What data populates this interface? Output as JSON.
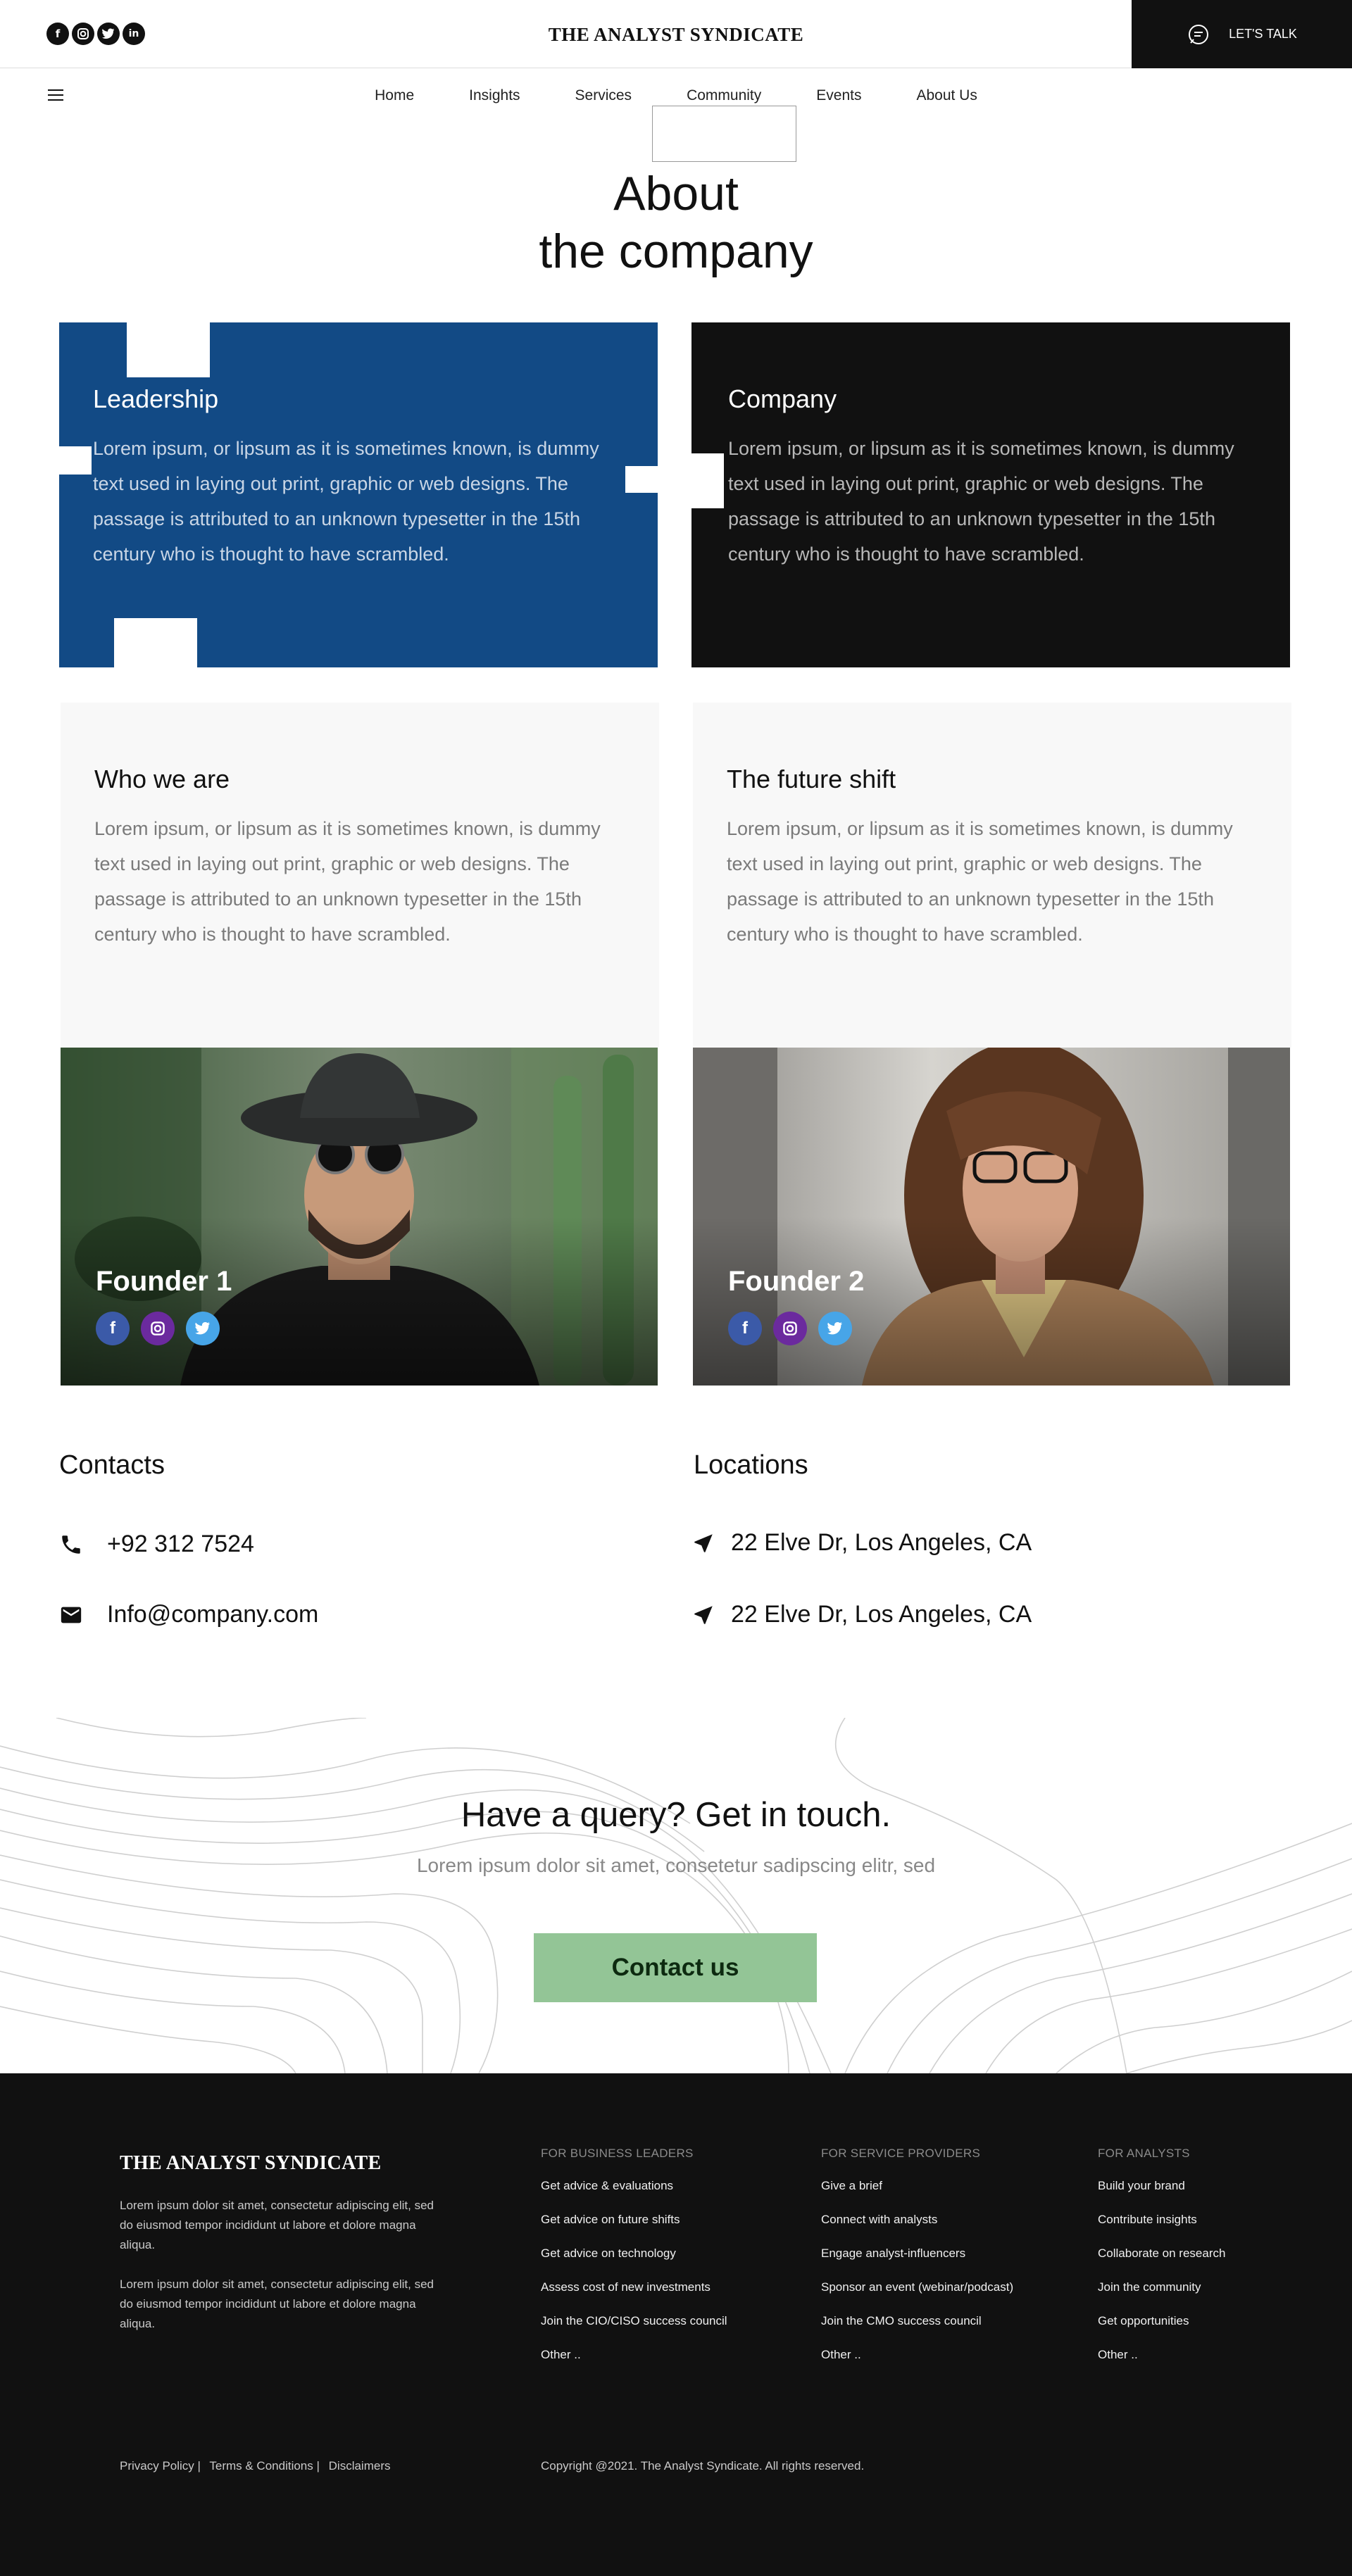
{
  "header": {
    "brand": "THE ANALYST SYNDICATE",
    "cta_label": "LET'S TALK",
    "social_icons": [
      "facebook-icon",
      "instagram-icon",
      "twitter-icon",
      "linkedin-icon"
    ]
  },
  "nav": {
    "items": [
      "Home",
      "Insights",
      "Services",
      "Community",
      "Events",
      "About Us"
    ]
  },
  "hero": {
    "line1": "About",
    "line2": "the company"
  },
  "cards": [
    {
      "title": "Leadership",
      "body": "Lorem ipsum, or lipsum as it is sometimes known, is dummy text used in laying out print, graphic or web designs. The passage is attributed to an unknown typesetter in the 15th century who is thought to have scrambled.",
      "color": "#124a85"
    },
    {
      "title": "Company",
      "body": "Lorem ipsum, or lipsum as it is sometimes known, is dummy text used in laying out print, graphic or web designs. The passage is attributed to an unknown typesetter in the 15th century who is thought to have scrambled.",
      "color": "#111111"
    },
    {
      "title": "Who we are",
      "body": "Lorem ipsum, or lipsum as it is sometimes known, is dummy text used in laying out print, graphic or web designs. The passage is attributed to an unknown typesetter in the 15th century who is thought to have scrambled.",
      "color": "#f8f8f8"
    },
    {
      "title": "The future shift",
      "body": "Lorem ipsum, or lipsum as it is sometimes known, is dummy text used in laying out print, graphic or web designs. The passage is attributed to an unknown typesetter in the 15th century who is thought to have scrambled.",
      "color": "#f8f8f8"
    }
  ],
  "founders": [
    {
      "name": "Founder 1",
      "icons": [
        "facebook-icon",
        "instagram-icon",
        "twitter-icon"
      ]
    },
    {
      "name": "Founder 2",
      "icons": [
        "facebook-icon",
        "instagram-icon",
        "twitter-icon"
      ]
    }
  ],
  "contacts": {
    "heading": "Contacts",
    "phone": "+92 312 7524",
    "email": "Info@company.com"
  },
  "locations": {
    "heading": "Locations",
    "items": [
      "22 Elve Dr, Los Angeles, CA",
      "22 Elve Dr, Los Angeles, CA"
    ]
  },
  "cta": {
    "title": "Have a query? Get in touch.",
    "subtitle": "Lorem ipsum dolor sit amet, consetetur sadipscing elitr, sed",
    "button": "Contact us",
    "button_color": "#93c596"
  },
  "footer": {
    "brand": "THE ANALYST SYNDICATE",
    "desc1": "Lorem ipsum dolor sit amet, consectetur adipiscing elit, sed do eiusmod tempor incididunt ut labore et dolore magna aliqua.",
    "desc2": "Lorem ipsum dolor sit amet, consectetur adipiscing elit, sed do eiusmod tempor incididunt ut labore et dolore magna aliqua.",
    "columns": [
      {
        "title": "FOR BUSINESS LEADERS",
        "items": [
          "Get advice & evaluations",
          "Get advice on future shifts",
          "Get advice on technology",
          "Assess cost of new investments",
          "Join the CIO/CISO success council",
          "Other .."
        ]
      },
      {
        "title": "FOR SERVICE PROVIDERS",
        "items": [
          "Give a brief",
          "Connect with analysts",
          "Engage analyst-influencers",
          "Sponsor an event (webinar/podcast)",
          "Join the CMO success council",
          "Other .."
        ]
      },
      {
        "title": "FOR ANALYSTS",
        "items": [
          "Build your brand",
          "Contribute insights",
          "Collaborate on research",
          "Join the community",
          "Get opportunities",
          "Other .."
        ]
      }
    ],
    "legal": [
      "Privacy Policy |",
      "Terms & Conditions |",
      "Disclaimers"
    ],
    "copyright": "Copyright @2021. The Analyst Syndicate. All rights reserved."
  }
}
